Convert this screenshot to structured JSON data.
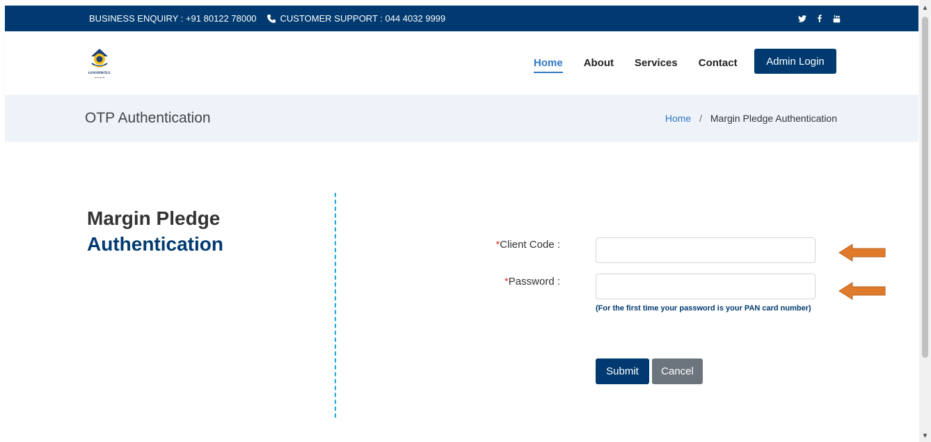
{
  "topbar": {
    "business_enquiry": "BUSINESS ENQUIRY : +91 80122 78000",
    "customer_support": "CUSTOMER SUPPORT : 044 4032 9999",
    "social": [
      "twitter-icon",
      "facebook-icon",
      "youtube-icon"
    ]
  },
  "header": {
    "logo_text": "GOODWILL",
    "nav": [
      "Home",
      "About",
      "Services",
      "Contact"
    ],
    "admin_login": "Admin Login"
  },
  "titlebar": {
    "title": "OTP Authentication",
    "breadcrumb": {
      "home": "Home",
      "separator": "/",
      "current": "Margin Pledge Authentication"
    }
  },
  "main": {
    "heading_line1": "Margin Pledge",
    "heading_line2": "Authentication",
    "client_code_label": "Client Code :",
    "password_label": "Password :",
    "required_mark": "*",
    "password_hint": "(For the first time your password is your PAN card number)",
    "submit_label": "Submit",
    "cancel_label": "Cancel"
  },
  "colors": {
    "brand": "#003a70",
    "link": "#2f78c6",
    "arrow": "#e07b2c",
    "divider": "#1aa3d9"
  }
}
